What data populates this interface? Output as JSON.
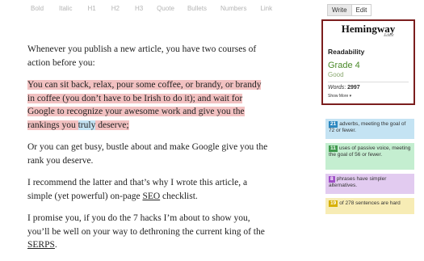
{
  "toolbar": {
    "items": [
      "Bold",
      "Italic",
      "H1",
      "H2",
      "H3",
      "Quote",
      "Bullets",
      "Numbers",
      "Link"
    ]
  },
  "mode": {
    "write": "Write",
    "edit": "Edit",
    "active": "Write"
  },
  "editor": {
    "p1": "Whenever you publish a new article, you have two courses of action before you:",
    "p2_a": "You can sit back, relax, pour some coffee, or brandy, or brandy in coffee (you don’t have to be Irish to do it); and wait for Google to recognize your awesome work and give you the rankings you ",
    "p2_b": "truly",
    "p2_c": " deserve;",
    "p3": "Or you can get busy, bustle about and make Google give you the rank you deserve.",
    "p4_a": "I recommend the latter and that’s why I wrote this article, a simple (yet powerful) on-page ",
    "p4_b": "SEO",
    "p4_c": " checklist.",
    "p5_a": "I promise you, if you do the 7 hacks I’m about to show you, you’ll be well on your way to dethroning the current king of the ",
    "p5_b": "SERPS",
    "p5_c": "."
  },
  "sidebar": {
    "logo": "Hemingway",
    "logo_sub": "Editor",
    "readability": "Readability",
    "grade": "Grade 4",
    "grade_desc": "Good",
    "words_label": "Words",
    "words_value": "2997",
    "show_more": "Show More ▾"
  },
  "cards": {
    "adverbs_num": "21",
    "adverbs_text": "adverbs, meeting the goal of 72 or fewer.",
    "passive_num": "11",
    "passive_text": "uses of passive voice, meeting the goal of 56 or fewer.",
    "simpler_num": "8",
    "simpler_text": "phrases have simpler alternatives.",
    "hard_num": "19",
    "hard_text": "of 278 sentences are hard"
  },
  "colors": {
    "brand_border": "#7b1e1e",
    "grade_green": "#4b8a2a",
    "adverb_blue": "#2b87c0",
    "passive_green": "#3f9a4d",
    "simpler_purple": "#a04fc8",
    "hard_yellow": "#d7b000"
  }
}
